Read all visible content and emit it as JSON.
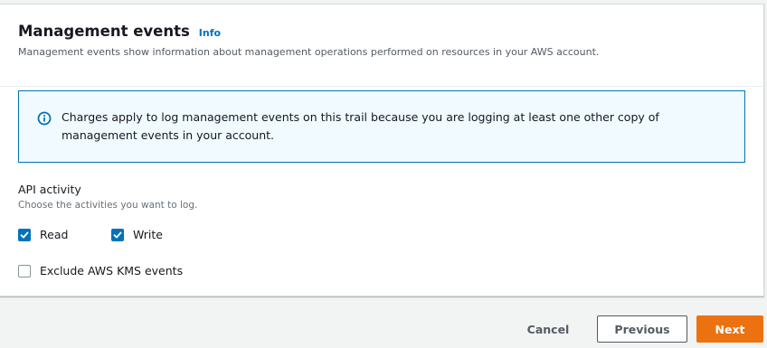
{
  "panel": {
    "title": "Management events",
    "info_link": "Info",
    "description": "Management events show information about management operations performed on resources in your AWS account."
  },
  "alert": {
    "icon": "info-circle-icon",
    "text": "Charges apply to log management events on this trail because you are logging at least one other copy of management events in your account."
  },
  "api_activity": {
    "label": "API activity",
    "description": "Choose the activities you want to log.",
    "options": [
      {
        "label": "Read",
        "checked": true
      },
      {
        "label": "Write",
        "checked": true
      }
    ]
  },
  "exclude_kms": {
    "label": "Exclude AWS KMS events",
    "checked": false
  },
  "footer": {
    "cancel_label": "Cancel",
    "previous_label": "Previous",
    "next_label": "Next"
  },
  "colors": {
    "accent": "#0073bb",
    "primary_button": "#ec7211",
    "alert_background": "#f1faff"
  }
}
